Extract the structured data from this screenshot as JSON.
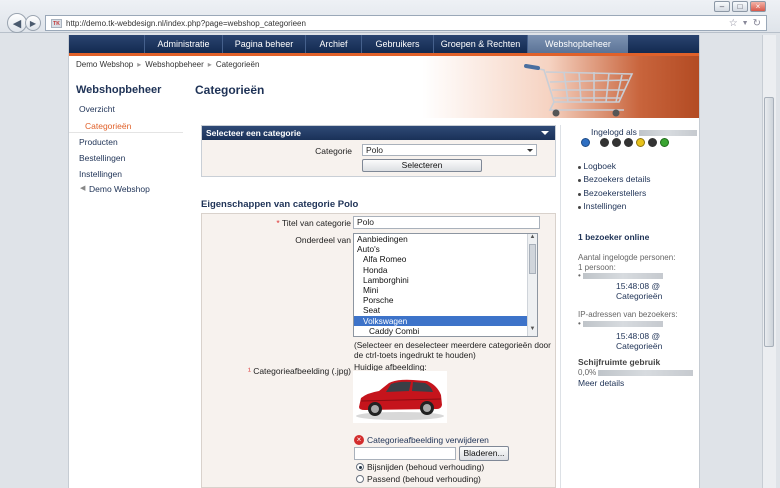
{
  "browser": {
    "url": "http://demo.tk-webdesign.nl/index.php?page=webshop_categorieen",
    "favicon_text": "TK"
  },
  "topnav": [
    "Administratie",
    "Pagina beheer",
    "Archief",
    "Gebruikers",
    "Groepen & Rechten",
    "Webshopbeheer"
  ],
  "breadcrumb": [
    "Demo Webshop",
    "Webshopbeheer",
    "Categorieën"
  ],
  "sidebar": {
    "title": "Webshopbeheer",
    "items": [
      "Overzicht",
      "Categorieën",
      "Producten",
      "Bestellingen",
      "Instellingen",
      "Demo Webshop"
    ]
  },
  "main": {
    "title": "Categorieën",
    "select_box": {
      "header": "Selecteer een categorie",
      "label": "Categorie",
      "value": "Polo",
      "button": "Selecteren"
    },
    "properties_title": "Eigenschappen van categorie Polo",
    "form": {
      "title_label": "Titel van categorie",
      "title_value": "Polo",
      "parent_label": "Onderdeel van",
      "parent_options": [
        "Aanbiedingen",
        "Auto's",
        "Alfa Romeo",
        "Honda",
        "Lamborghini",
        "Mini",
        "Porsche",
        "Seat",
        "Volkswagen",
        "Caddy Combi"
      ],
      "parent_selected": "Volkswagen",
      "parent_help": "(Selecteer en deselecteer meerdere categorieën door de ctrl-toets ingedrukt te houden)",
      "image_label": "Categorieafbeelding (.jpg)",
      "current_image_label": "Huidige afbeelding:",
      "remove_image": "Categorieafbeelding verwijderen",
      "browse_button": "Bladeren...",
      "radio_crop": "Bijsnijden (behoud verhouding)",
      "radio_fit": "Passend (behoud verhouding)"
    }
  },
  "right": {
    "logged_in": "Ingelogd als",
    "links": [
      "Logboek",
      "Bezoekers details",
      "Bezoekerstellers",
      "Instellingen"
    ],
    "online": "1 bezoeker online",
    "logged_persons_label": "Aantal ingelogde personen:",
    "logged_persons_count": "1 persoon:",
    "time1": "15:48:08",
    "loc1": "@ Categorieën",
    "ip_label": "IP-adressen van bezoekers:",
    "time2": "15:48:08",
    "loc2": "@ Categorieën",
    "disk_label": "Schijfruimte gebruik",
    "disk_value": "0,0%",
    "more": "Meer details"
  },
  "colors": {
    "nav": "#1a3158",
    "accent_orange": "#e0612a",
    "selected": "#3d73c9"
  }
}
